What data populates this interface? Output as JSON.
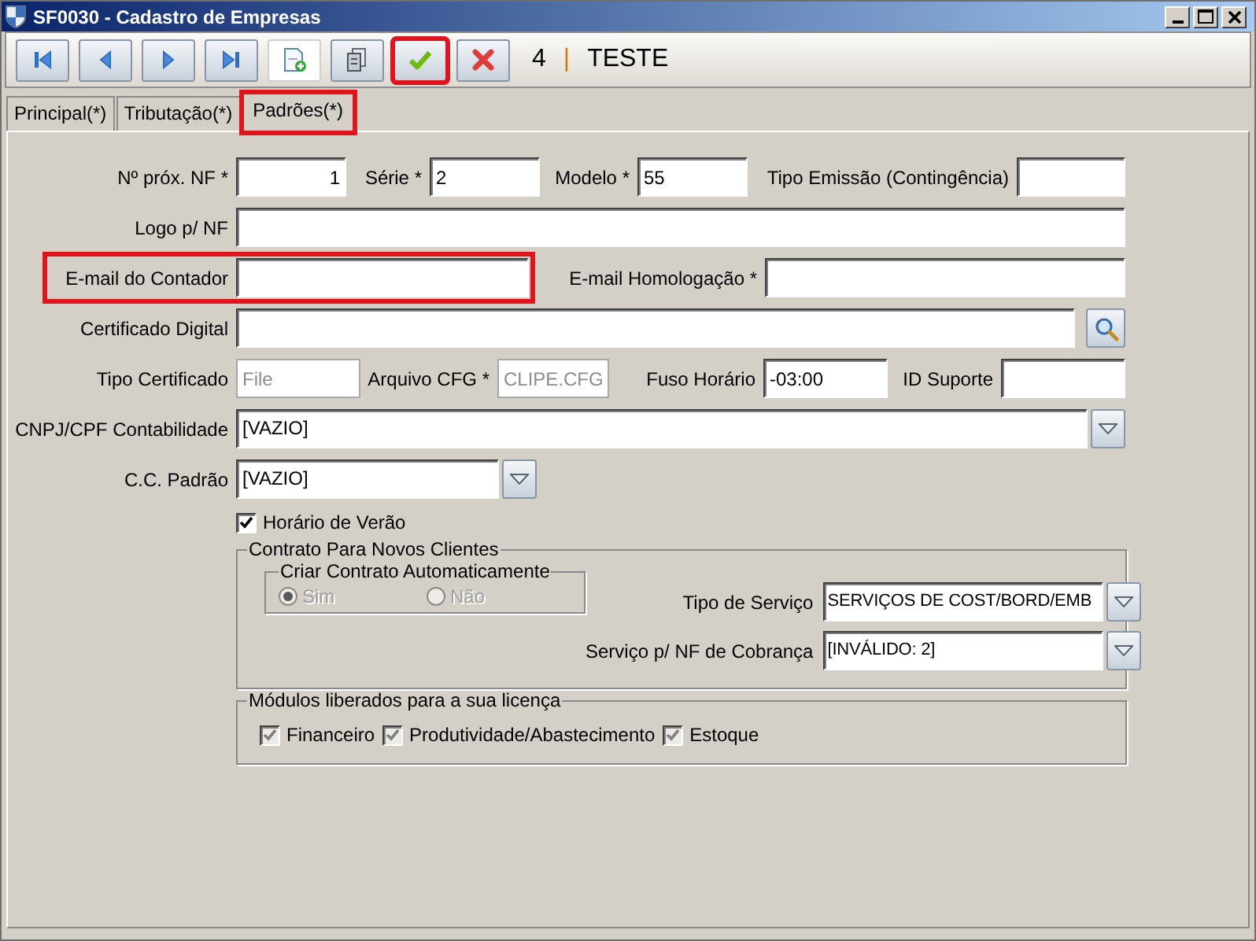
{
  "window": {
    "title": "SF0030 - Cadastro de Empresas"
  },
  "toolbar": {
    "buttons": [
      {
        "kind": "first",
        "highlighted": false
      },
      {
        "kind": "previous",
        "highlighted": false
      },
      {
        "kind": "next",
        "highlighted": false
      },
      {
        "kind": "last",
        "highlighted": false
      },
      {
        "kind": "new",
        "highlighted": false
      },
      {
        "kind": "copy",
        "highlighted": false
      },
      {
        "kind": "confirm",
        "highlighted": true
      },
      {
        "kind": "cancel",
        "highlighted": false
      }
    ],
    "record_number": "4",
    "separator": "|",
    "record_name": "TESTE"
  },
  "tabs": [
    {
      "label": "Principal(*)",
      "selected": false,
      "highlighted": false
    },
    {
      "label": "Tributação(*)",
      "selected": false,
      "highlighted": false
    },
    {
      "label": "Padrões(*)",
      "selected": true,
      "highlighted": true
    }
  ],
  "form": {
    "rows": [
      [
        {
          "kind": "number",
          "label": "Nº próx. NF *",
          "value": "1",
          "disabled": false,
          "highlighted": false
        },
        {
          "kind": "text",
          "label": "Série *",
          "value": "2",
          "disabled": false,
          "highlighted": false
        },
        {
          "kind": "text",
          "label": "Modelo *",
          "value": "55",
          "disabled": false,
          "highlighted": false
        },
        {
          "kind": "text",
          "label": "Tipo Emissão (Contingência)",
          "disabled": false,
          "highlighted": false
        }
      ],
      [
        {
          "kind": "text",
          "label": "Logo p/ NF",
          "disabled": false,
          "highlighted": false
        }
      ],
      [
        {
          "kind": "text",
          "label": "E-mail do Contador",
          "disabled": false,
          "highlighted": true
        },
        {
          "kind": "text",
          "label": "E-mail Homologação *",
          "disabled": false,
          "highlighted": false
        }
      ],
      [
        {
          "kind": "search",
          "label": "Certificado Digital",
          "disabled": false,
          "highlighted": false
        }
      ],
      [
        {
          "kind": "text",
          "label": "Tipo Certificado",
          "value": "File",
          "disabled": true,
          "highlighted": false
        },
        {
          "kind": "text",
          "label": "Arquivo CFG *",
          "value": "CLIPE.CFG",
          "disabled": true,
          "highlighted": false
        },
        {
          "kind": "text",
          "label": "Fuso Horário",
          "value": "-03:00",
          "disabled": false,
          "highlighted": false
        },
        {
          "kind": "text",
          "label": "ID Suporte",
          "disabled": false,
          "highlighted": false
        }
      ],
      [
        {
          "kind": "select",
          "label": "CNPJ/CPF Contabilidade",
          "value": "[VAZIO]",
          "disabled": false,
          "highlighted": false
        }
      ],
      [
        {
          "kind": "select",
          "label": "C.C. Padrão",
          "value": "[VAZIO]",
          "disabled": false,
          "highlighted": false
        }
      ]
    ]
  },
  "daylight_saving": {
    "label": "Horário de Verão",
    "checked": true,
    "disabled": false
  },
  "contract_group": {
    "title": "Contrato Para Novos Clientes",
    "auto_contract": {
      "title": "Criar Contrato Automaticamente",
      "options": [
        {
          "label": "Sim",
          "selected": true,
          "disabled": true
        },
        {
          "label": "Não",
          "selected": false,
          "disabled": true
        }
      ]
    },
    "fields": [
      {
        "label": "Tipo de Serviço",
        "value": "SERVIÇOS DE COST/BORD/EMB"
      },
      {
        "label": "Serviço p/ NF de Cobrança",
        "value": "[INVÁLIDO: 2]"
      }
    ]
  },
  "modules_group": {
    "title": "Módulos liberados para a sua licença",
    "modules": [
      {
        "label": "Financeiro",
        "checked": true,
        "disabled": true
      },
      {
        "label": "Produtividade/Abastecimento",
        "checked": true,
        "disabled": true
      },
      {
        "label": "Estoque",
        "checked": true,
        "disabled": true
      }
    ]
  }
}
